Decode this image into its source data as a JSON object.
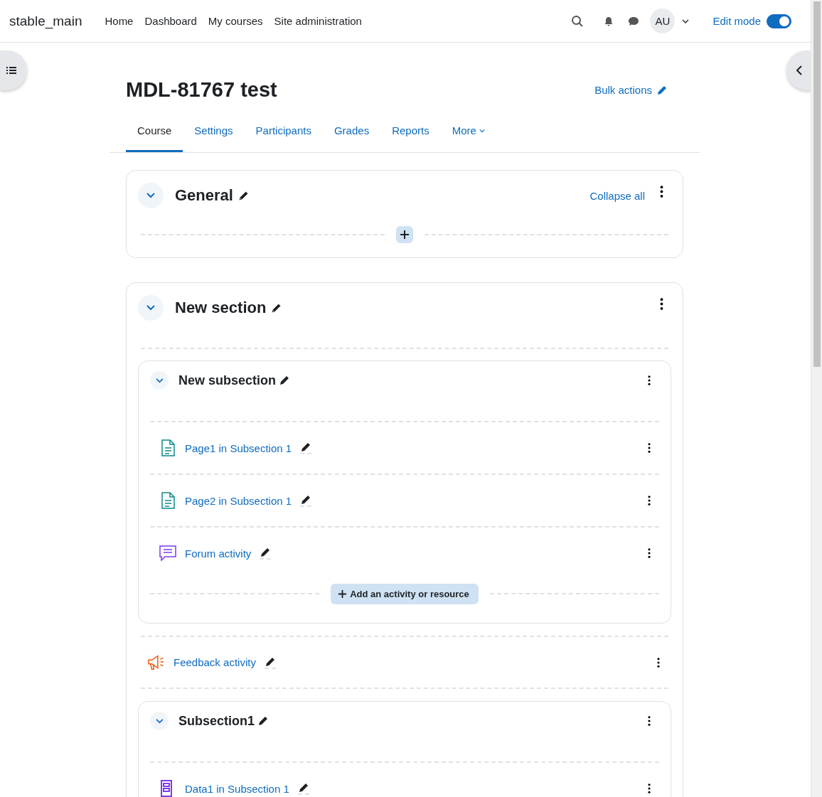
{
  "navbar": {
    "site_name": "stable_main",
    "links": [
      "Home",
      "Dashboard",
      "My courses",
      "Site administration"
    ],
    "user_initials": "AU",
    "edit_mode": {
      "label": "Edit mode",
      "on": true
    }
  },
  "course": {
    "title": "MDL-81767 test",
    "bulk_actions": "Bulk actions"
  },
  "tabs": [
    {
      "label": "Course",
      "selected": true
    },
    {
      "label": "Settings",
      "selected": false
    },
    {
      "label": "Participants",
      "selected": false
    },
    {
      "label": "Grades",
      "selected": false
    },
    {
      "label": "Reports",
      "selected": false
    },
    {
      "label": "More",
      "selected": false
    }
  ],
  "sections": [
    {
      "title": "General",
      "expanded": true,
      "collapse_all": "Collapse all"
    },
    {
      "title": "New section",
      "expanded": true,
      "items": [
        {
          "kind": "subsection",
          "title": "New subsection",
          "expanded": true,
          "add_label": "Add an activity or resource",
          "activities": [
            {
              "kind": "page",
              "name": "Page1 in Subsection 1"
            },
            {
              "kind": "page",
              "name": "Page2 in Subsection 1"
            },
            {
              "kind": "forum",
              "name": "Forum activity"
            }
          ]
        },
        {
          "kind": "feedback",
          "name": "Feedback activity"
        },
        {
          "kind": "subsection",
          "title": "Subsection1",
          "expanded": true,
          "activities": [
            {
              "kind": "data",
              "name": "Data1 in Subsection 1"
            }
          ]
        }
      ]
    }
  ]
}
